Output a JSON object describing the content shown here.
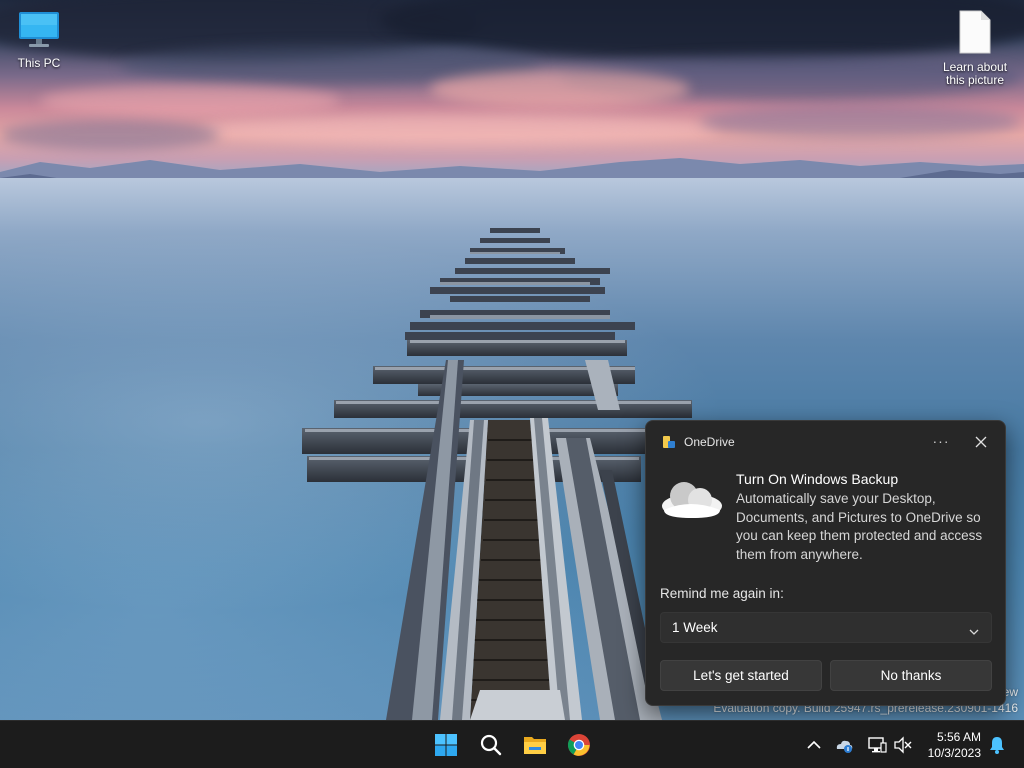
{
  "desktop": {
    "icons": [
      {
        "label": "This PC",
        "icon": "monitor-icon"
      },
      {
        "label": "Learn about this picture",
        "icon": "file-icon"
      }
    ]
  },
  "watermark": {
    "line1": "ew",
    "line2": "Evaluation copy. Build 25947.rs_prerelease.230901-1416"
  },
  "toast": {
    "app_name": "OneDrive",
    "more_label": "···",
    "title": "Turn On Windows Backup",
    "body": "Automatically save your Desktop, Documents, and Pictures to OneDrive so you can keep them protected and access them from anywhere.",
    "remind_label": "Remind me again in:",
    "remind_value": "1 Week",
    "primary_button": "Let's get started",
    "secondary_button": "No thanks"
  },
  "taskbar": {
    "apps": [
      "start-icon",
      "search-icon",
      "file-explorer-icon",
      "chrome-icon"
    ],
    "tray": [
      "chevron-up-icon",
      "onedrive-cloud-icon",
      "network-icon",
      "volume-muted-icon"
    ],
    "clock": {
      "time": "5:56 AM",
      "date": "10/3/2023"
    },
    "notifications": "bell-icon"
  },
  "colors": {
    "taskbar": "#1c1c1c",
    "toast_bg": "#272727",
    "button_bg": "#373737",
    "accent_blue": "#4cc2ff"
  }
}
